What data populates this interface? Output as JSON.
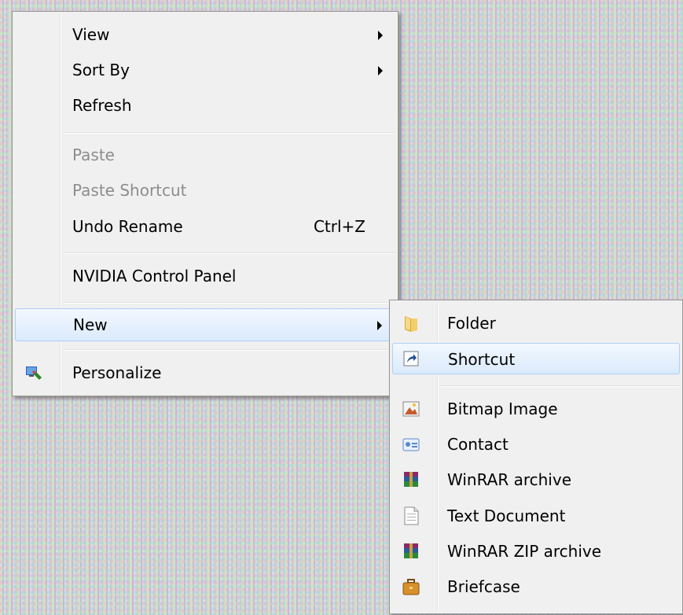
{
  "context_menu": {
    "items": [
      {
        "label": "View"
      },
      {
        "label": "Sort By"
      },
      {
        "label": "Refresh"
      },
      {
        "label": "Paste"
      },
      {
        "label": "Paste Shortcut"
      },
      {
        "label": "Undo Rename",
        "shortcut": "Ctrl+Z"
      },
      {
        "label": "NVIDIA Control Panel"
      },
      {
        "label": "New"
      },
      {
        "label": "Personalize"
      }
    ]
  },
  "new_submenu": {
    "items": [
      {
        "label": "Folder",
        "icon": "folder-icon"
      },
      {
        "label": "Shortcut",
        "icon": "shortcut-icon"
      },
      {
        "label": "Bitmap Image",
        "icon": "bitmap-image-icon"
      },
      {
        "label": "Contact",
        "icon": "contact-icon"
      },
      {
        "label": "WinRAR archive",
        "icon": "winrar-archive-icon"
      },
      {
        "label": "Text Document",
        "icon": "text-document-icon"
      },
      {
        "label": "WinRAR ZIP archive",
        "icon": "winrar-zip-icon"
      },
      {
        "label": "Briefcase",
        "icon": "briefcase-icon"
      }
    ]
  },
  "colors": {
    "highlight_border": "#aecff7",
    "disabled_text": "#8d8d8d",
    "menu_bg": "#f0f0f0"
  }
}
